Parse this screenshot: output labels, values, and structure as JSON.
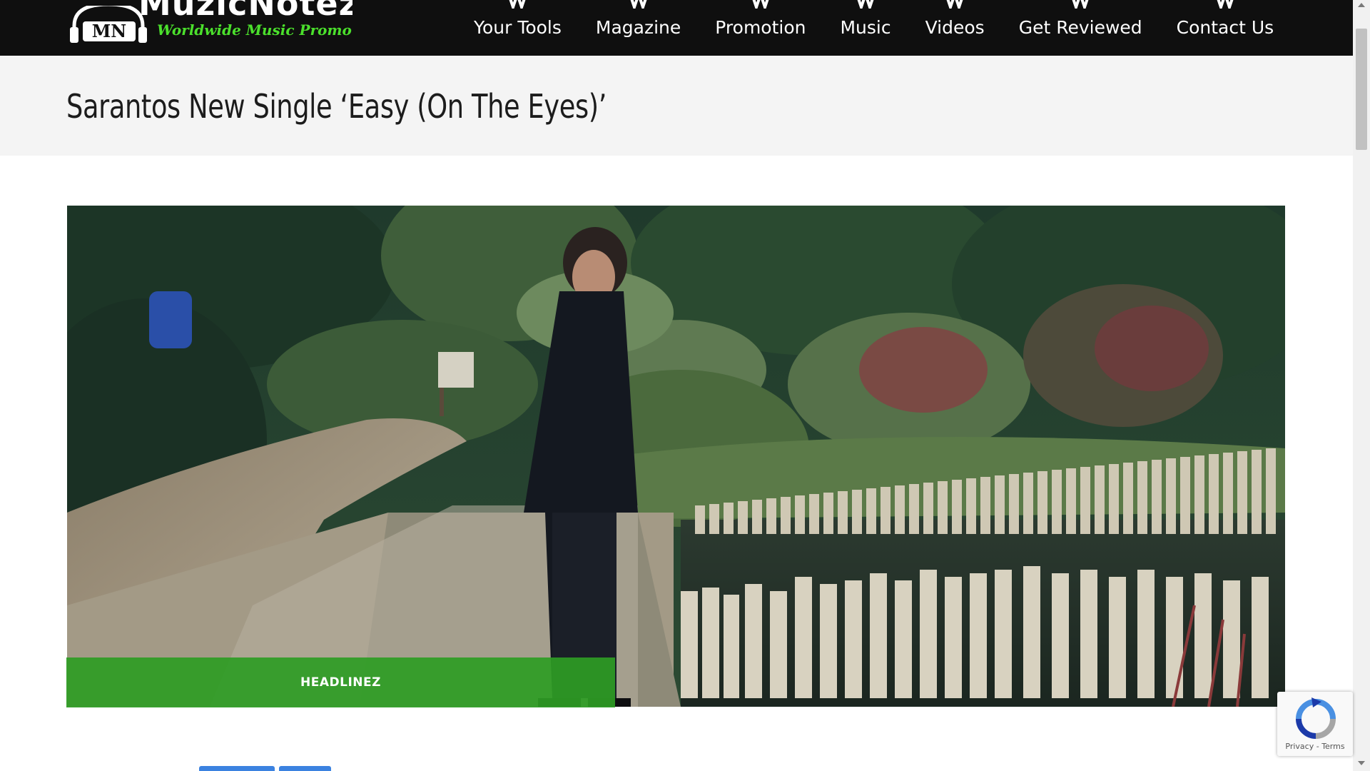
{
  "site": {
    "logo_badge": "MN",
    "logo_badge_small": "muzicnotez",
    "logo_title": "MuzicNotez",
    "tagline": "Worldwide Music Promotion"
  },
  "nav": {
    "items": [
      {
        "label": "Your Tools"
      },
      {
        "label": "Magazine"
      },
      {
        "label": "Promotion"
      },
      {
        "label": "Music"
      },
      {
        "label": "Videos"
      },
      {
        "label": "Get Reviewed"
      },
      {
        "label": "Contact Us"
      }
    ]
  },
  "article": {
    "title": "Sarantos New Single ‘Easy (On The Eyes)’",
    "category": "HEADLINEZ"
  },
  "recaptcha": {
    "privacy": "Privacy",
    "separator": " - ",
    "terms": "Terms"
  },
  "colors": {
    "header_bg": "#0f0f0f",
    "title_band_bg": "#f4f4f4",
    "tagline_green": "#4be02c",
    "category_green": "#2e9c24",
    "share_blue": "#3b82e0"
  }
}
